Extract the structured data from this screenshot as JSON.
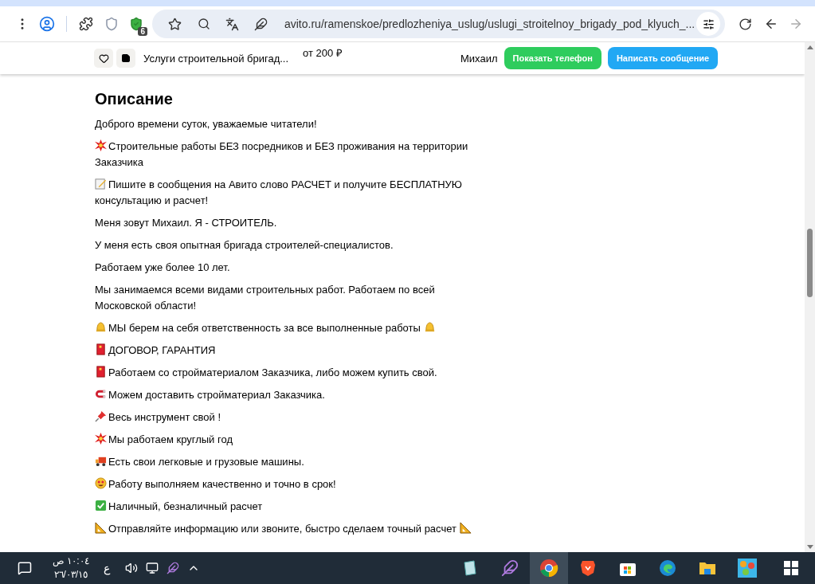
{
  "browser": {
    "url": "avito.ru/ramenskoe/predlozheniya_uslug/uslugi_stroitelnoy_brigady_pod_klyuch_...",
    "extension_badge": "6"
  },
  "sticky_header": {
    "title": "Услуги строительной бригад...",
    "price": "от 200 ₽",
    "seller": "Михаил",
    "buttons": [
      {
        "label": "Показать телефон",
        "kind": "call"
      },
      {
        "label": "Написать сообщение",
        "kind": "message"
      }
    ]
  },
  "description": {
    "heading": "Описание",
    "paragraphs": [
      {
        "text": "Доброго времени суток, уважаемые читатели!",
        "kind": "plain"
      },
      {
        "text": "Строительные работы БЕЗ посредников и БЕЗ проживания на территории Заказчика",
        "kind": "collision"
      },
      {
        "text": "Пишите в сообщения на Авито слово РАСЧЕТ и получите БЕСПЛАТНУЮ консультацию и расчет!",
        "kind": "memo"
      },
      {
        "text": "Меня зовут Михаил. Я - СТРОИТЕЛЬ.",
        "kind": "plain"
      },
      {
        "text": "У меня есть своя опытная бригада строителей-специалистов.",
        "kind": "plain"
      },
      {
        "text": "Работаем уже более 10 лет.",
        "kind": "plain"
      },
      {
        "text": "Мы занимаемся всеми видами строительных работ. Работаем по всей Московской области!",
        "kind": "plain"
      },
      {
        "text": "МЫ берем на себя ответственность за все выполненные работы",
        "kind": "bell",
        "end_icon": true
      },
      {
        "text": "ДОГОВОР, ГАРАНТИЯ",
        "kind": "card"
      },
      {
        "text": "Работаем со стройматериалом Заказчика, либо можем купить свой.",
        "kind": "card"
      },
      {
        "text": "Можем доставить стройматериал Заказчика.",
        "kind": "magnet"
      },
      {
        "text": "Весь инструмент свой !",
        "kind": "pin"
      },
      {
        "text": "Мы работаем круглый год",
        "kind": "collision"
      },
      {
        "text": "Есть свои легковые и грузовые машины.",
        "kind": "truck"
      },
      {
        "text": "Работу выполняем качественно и точно в срок!",
        "kind": "starface"
      },
      {
        "text": "Наличный, безналичный расчет",
        "kind": "check"
      },
      {
        "text": "Отправляйте информацию или звоните, быстро сделаем точный расчет",
        "kind": "ruler",
        "end_icon": true
      }
    ]
  },
  "taskbar": {
    "time": "١٠:٠٤ ص",
    "date": "٢٦/٠٣/١٥",
    "language": "ع"
  }
}
